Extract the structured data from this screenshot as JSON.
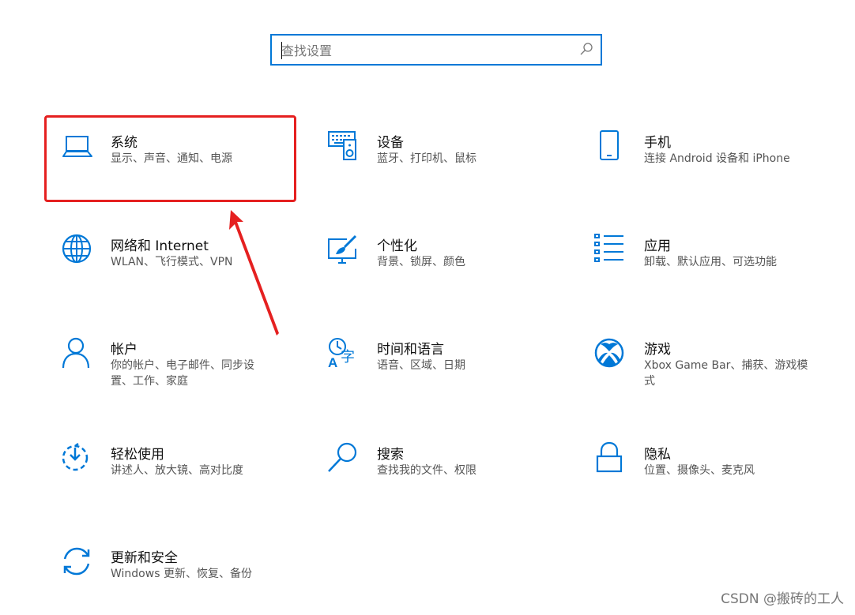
{
  "search": {
    "placeholder": "查找设置"
  },
  "tiles": [
    {
      "title": "系统",
      "desc": "显示、声音、通知、电源",
      "icon": "laptop-icon"
    },
    {
      "title": "设备",
      "desc": "蓝牙、打印机、鼠标",
      "icon": "keyboard-speaker-icon"
    },
    {
      "title": "手机",
      "desc": "连接 Android 设备和 iPhone",
      "icon": "phone-icon"
    },
    {
      "title": "网络和 Internet",
      "desc": "WLAN、飞行模式、VPN",
      "icon": "globe-icon"
    },
    {
      "title": "个性化",
      "desc": "背景、锁屏、颜色",
      "icon": "paint-brush-icon"
    },
    {
      "title": "应用",
      "desc": "卸载、默认应用、可选功能",
      "icon": "apps-list-icon"
    },
    {
      "title": "帐户",
      "desc": "你的帐户、电子邮件、同步设置、工作、家庭",
      "icon": "person-icon"
    },
    {
      "title": "时间和语言",
      "desc": "语音、区域、日期",
      "icon": "time-language-icon"
    },
    {
      "title": "游戏",
      "desc": "Xbox Game Bar、捕获、游戏模式",
      "icon": "xbox-icon"
    },
    {
      "title": "轻松使用",
      "desc": "讲述人、放大镜、高对比度",
      "icon": "ease-of-access-icon"
    },
    {
      "title": "搜索",
      "desc": "查找我的文件、权限",
      "icon": "search-icon"
    },
    {
      "title": "隐私",
      "desc": "位置、摄像头、麦克风",
      "icon": "lock-icon"
    },
    {
      "title": "更新和安全",
      "desc": "Windows 更新、恢复、备份",
      "icon": "sync-icon"
    }
  ],
  "watermark": "CSDN @搬砖的工人",
  "colors": {
    "accent": "#0078d7",
    "highlight": "#e52020"
  }
}
